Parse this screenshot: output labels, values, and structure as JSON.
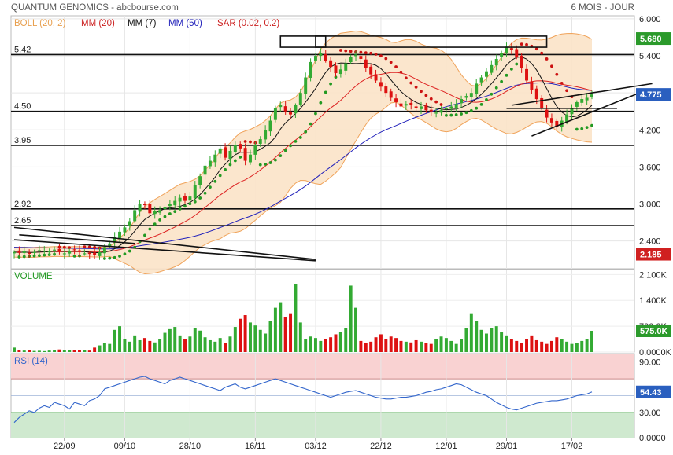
{
  "header": {
    "title": "QUANTUM GENOMICS - abcbourse.com",
    "period": "6 MOIS - JOUR"
  },
  "legend": {
    "boll": "BOLL (20, 2)",
    "mm20": "MM (20)",
    "mm7": "MM (7)",
    "mm50": "MM (50)",
    "sar": "SAR (0.02, 0.2)"
  },
  "colors": {
    "up": "#33aa33",
    "down": "#dd1111",
    "boll_fill": "#fbe3c8",
    "boll_line": "#f0a35a",
    "mm20": "#dd2222",
    "mm7": "#111111",
    "mm50": "#2222bb",
    "sar_up": "#229922",
    "sar_down": "#cc1111",
    "rsi_line": "#3366cc",
    "rsi_over": "#f9d2d2",
    "rsi_under": "#cfe9cf",
    "badge_green": "#2b9a2b",
    "badge_blue": "#2a5fbf",
    "badge_red": "#d02020"
  },
  "price_panel": {
    "y_ticks": [
      "6.000",
      "5.400",
      "4.800",
      "4.200",
      "3.600",
      "3.000",
      "2.400"
    ],
    "y_tick_values": [
      6.0,
      5.4,
      4.8,
      4.2,
      3.6,
      3.0,
      2.4
    ],
    "ylim": [
      1.95,
      6.05
    ],
    "levels": [
      {
        "value": 5.42,
        "label": "5.42"
      },
      {
        "value": 4.5,
        "label": "4.50"
      },
      {
        "value": 3.95,
        "label": "3.95"
      },
      {
        "value": 2.92,
        "label": "2.92"
      },
      {
        "value": 2.65,
        "label": "2.65"
      }
    ],
    "badges": [
      {
        "text": "5.680",
        "value": 5.68,
        "color": "#2b9a2b"
      },
      {
        "text": "4.775",
        "value": 4.775,
        "color": "#2a5fbf"
      },
      {
        "text": "2.185",
        "value": 2.185,
        "color": "#d02020"
      }
    ]
  },
  "volume_panel": {
    "label": "VOLUME",
    "y_ticks": [
      "2 100K",
      "1 400K",
      "700.0K",
      "0.0000K"
    ],
    "y_tick_values": [
      2100,
      1400,
      700,
      0
    ],
    "ylim": [
      0,
      2150
    ],
    "badge": {
      "text": "575.0K",
      "value": 575,
      "color": "#2b9a2b"
    }
  },
  "rsi_panel": {
    "label": "RSI (14)",
    "y_ticks": [
      "90.00",
      "30.00",
      "0.0000"
    ],
    "y_tick_values": [
      90,
      30,
      0
    ],
    "ylim": [
      0,
      100
    ],
    "overbought": 70,
    "oversold": 30,
    "badge": {
      "text": "54.43",
      "value": 54.43,
      "color": "#2a5fbf"
    }
  },
  "x_axis": {
    "labels": [
      "22/09",
      "09/10",
      "28/10",
      "16/11",
      "03/12",
      "22/12",
      "12/01",
      "29/01",
      "17/02"
    ],
    "label_index": [
      10,
      22,
      35,
      48,
      60,
      73,
      86,
      98,
      111
    ]
  },
  "chart_data": {
    "type": "candlestick",
    "n": 116,
    "closes": [
      2.22,
      2.21,
      2.23,
      2.2,
      2.22,
      2.25,
      2.24,
      2.23,
      2.26,
      2.22,
      2.2,
      2.24,
      2.25,
      2.22,
      2.2,
      2.19,
      2.17,
      2.22,
      2.3,
      2.36,
      2.47,
      2.55,
      2.62,
      2.72,
      2.9,
      3.0,
      2.98,
      2.85,
      2.88,
      2.9,
      2.95,
      3.0,
      3.05,
      3.1,
      3.05,
      3.12,
      3.3,
      3.45,
      3.62,
      3.7,
      3.8,
      3.9,
      3.75,
      3.86,
      3.95,
      3.9,
      3.7,
      3.8,
      3.95,
      4.05,
      4.2,
      4.35,
      4.55,
      4.6,
      4.5,
      4.45,
      4.6,
      4.8,
      5.05,
      5.3,
      5.4,
      5.45,
      5.32,
      5.22,
      5.12,
      5.18,
      5.28,
      5.38,
      5.42,
      5.35,
      5.2,
      5.1,
      5.0,
      4.9,
      4.8,
      4.72,
      4.65,
      4.58,
      4.62,
      4.6,
      4.55,
      4.58,
      4.52,
      4.5,
      4.48,
      4.52,
      4.55,
      4.58,
      4.62,
      4.7,
      4.75,
      4.8,
      4.95,
      5.05,
      5.15,
      5.25,
      5.35,
      5.45,
      5.55,
      5.5,
      5.38,
      5.2,
      5.0,
      4.85,
      4.7,
      4.55,
      4.4,
      4.32,
      4.25,
      4.35,
      4.45,
      4.55,
      4.65,
      4.7,
      4.72,
      4.775
    ],
    "volumes": [
      120,
      60,
      40,
      50,
      30,
      35,
      25,
      40,
      55,
      70,
      45,
      60,
      55,
      50,
      45,
      40,
      120,
      180,
      250,
      220,
      600,
      700,
      350,
      280,
      450,
      320,
      380,
      300,
      260,
      350,
      520,
      620,
      680,
      450,
      350,
      420,
      650,
      580,
      400,
      320,
      280,
      380,
      250,
      420,
      680,
      900,
      1000,
      800,
      720,
      600,
      500,
      850,
      1200,
      1350,
      950,
      1050,
      1850,
      800,
      350,
      420,
      380,
      300,
      350,
      400,
      480,
      550,
      650,
      1800,
      1200,
      300,
      250,
      280,
      400,
      480,
      350,
      420,
      380,
      300,
      280,
      260,
      320,
      280,
      250,
      220,
      350,
      420,
      380,
      300,
      220,
      350,
      650,
      1050,
      850,
      600,
      500,
      650,
      700,
      550,
      450,
      350,
      300,
      250,
      350,
      450,
      320,
      280,
      220,
      300,
      400,
      350,
      280,
      220,
      250,
      300,
      350,
      575
    ],
    "rsi": [
      18,
      24,
      28,
      32,
      30,
      35,
      38,
      36,
      42,
      40,
      38,
      34,
      42,
      40,
      38,
      44,
      46,
      50,
      58,
      60,
      62,
      64,
      66,
      68,
      70,
      72,
      73,
      70,
      68,
      66,
      64,
      68,
      70,
      72,
      70,
      68,
      66,
      64,
      62,
      60,
      58,
      56,
      60,
      62,
      64,
      60,
      58,
      60,
      62,
      64,
      66,
      68,
      70,
      68,
      66,
      64,
      62,
      60,
      58,
      56,
      54,
      52,
      50,
      48,
      50,
      52,
      54,
      55,
      56,
      54,
      52,
      50,
      48,
      47,
      46,
      46,
      47,
      48,
      48,
      49,
      50,
      52,
      54,
      55,
      57,
      58,
      60,
      62,
      64,
      63,
      60,
      57,
      54,
      52,
      50,
      46,
      42,
      39,
      36,
      34,
      33,
      35,
      37,
      39,
      41,
      42,
      43,
      44,
      44,
      45,
      46,
      48,
      50,
      51,
      52,
      54.43
    ]
  }
}
